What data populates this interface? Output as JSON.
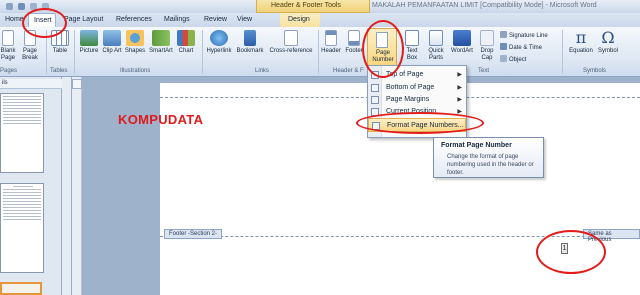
{
  "titlebar": {
    "contextual_header": "Header & Footer Tools",
    "document_title": "MAKALAH PEMANFAATAN LIMIT [Compatibility Mode] - Microsoft Word"
  },
  "tabs": [
    "Home",
    "Insert",
    "Page Layout",
    "References",
    "Mailings",
    "Review",
    "View",
    "Design"
  ],
  "ribbon": {
    "pages_group": {
      "label": "Pages",
      "items": [
        "Blank Page",
        "Page Break"
      ]
    },
    "tables_group": {
      "label": "Tables",
      "items": [
        "Table"
      ]
    },
    "illustrations_group": {
      "label": "Illustrations",
      "items": [
        "Picture",
        "Clip Art",
        "Shapes",
        "SmartArt",
        "Chart"
      ]
    },
    "links_group": {
      "label": "Links",
      "items": [
        "Hyperlink",
        "Bookmark",
        "Cross-reference"
      ]
    },
    "header_footer_group": {
      "label": "Header & F",
      "items": [
        "Header",
        "Footer",
        "Page Number"
      ]
    },
    "text_group": {
      "label": "Text",
      "items": [
        "Text Box",
        "Quick Parts",
        "WordArt",
        "Drop Cap"
      ],
      "side_items": [
        "Signature Line",
        "Date & Time",
        "Object"
      ]
    },
    "symbols_group": {
      "label": "Symbols",
      "items": [
        "Equation",
        "Symbol"
      ]
    }
  },
  "left_pane": {
    "header": "ils"
  },
  "document": {
    "watermark_text": "KOMPUDATA",
    "footer_tag": "Footer -Section 2-",
    "same_as_previous": "Same as Previous",
    "page_number": "1"
  },
  "menu": {
    "items": [
      {
        "label": "Top of Page",
        "has_arrow": true
      },
      {
        "label": "Bottom of Page",
        "has_arrow": true
      },
      {
        "label": "Page Margins",
        "has_arrow": true
      },
      {
        "label": "Current Position",
        "has_arrow": true
      },
      {
        "label": "Format Page Numbers...",
        "has_arrow": false
      }
    ]
  },
  "tooltip": {
    "title": "Format Page Number",
    "body": "Change the format of page numbering used in the header or footer."
  },
  "colors": {
    "accent": "#f8d889",
    "annotation": "#e31b1b",
    "watermark": "#e01b1b"
  }
}
